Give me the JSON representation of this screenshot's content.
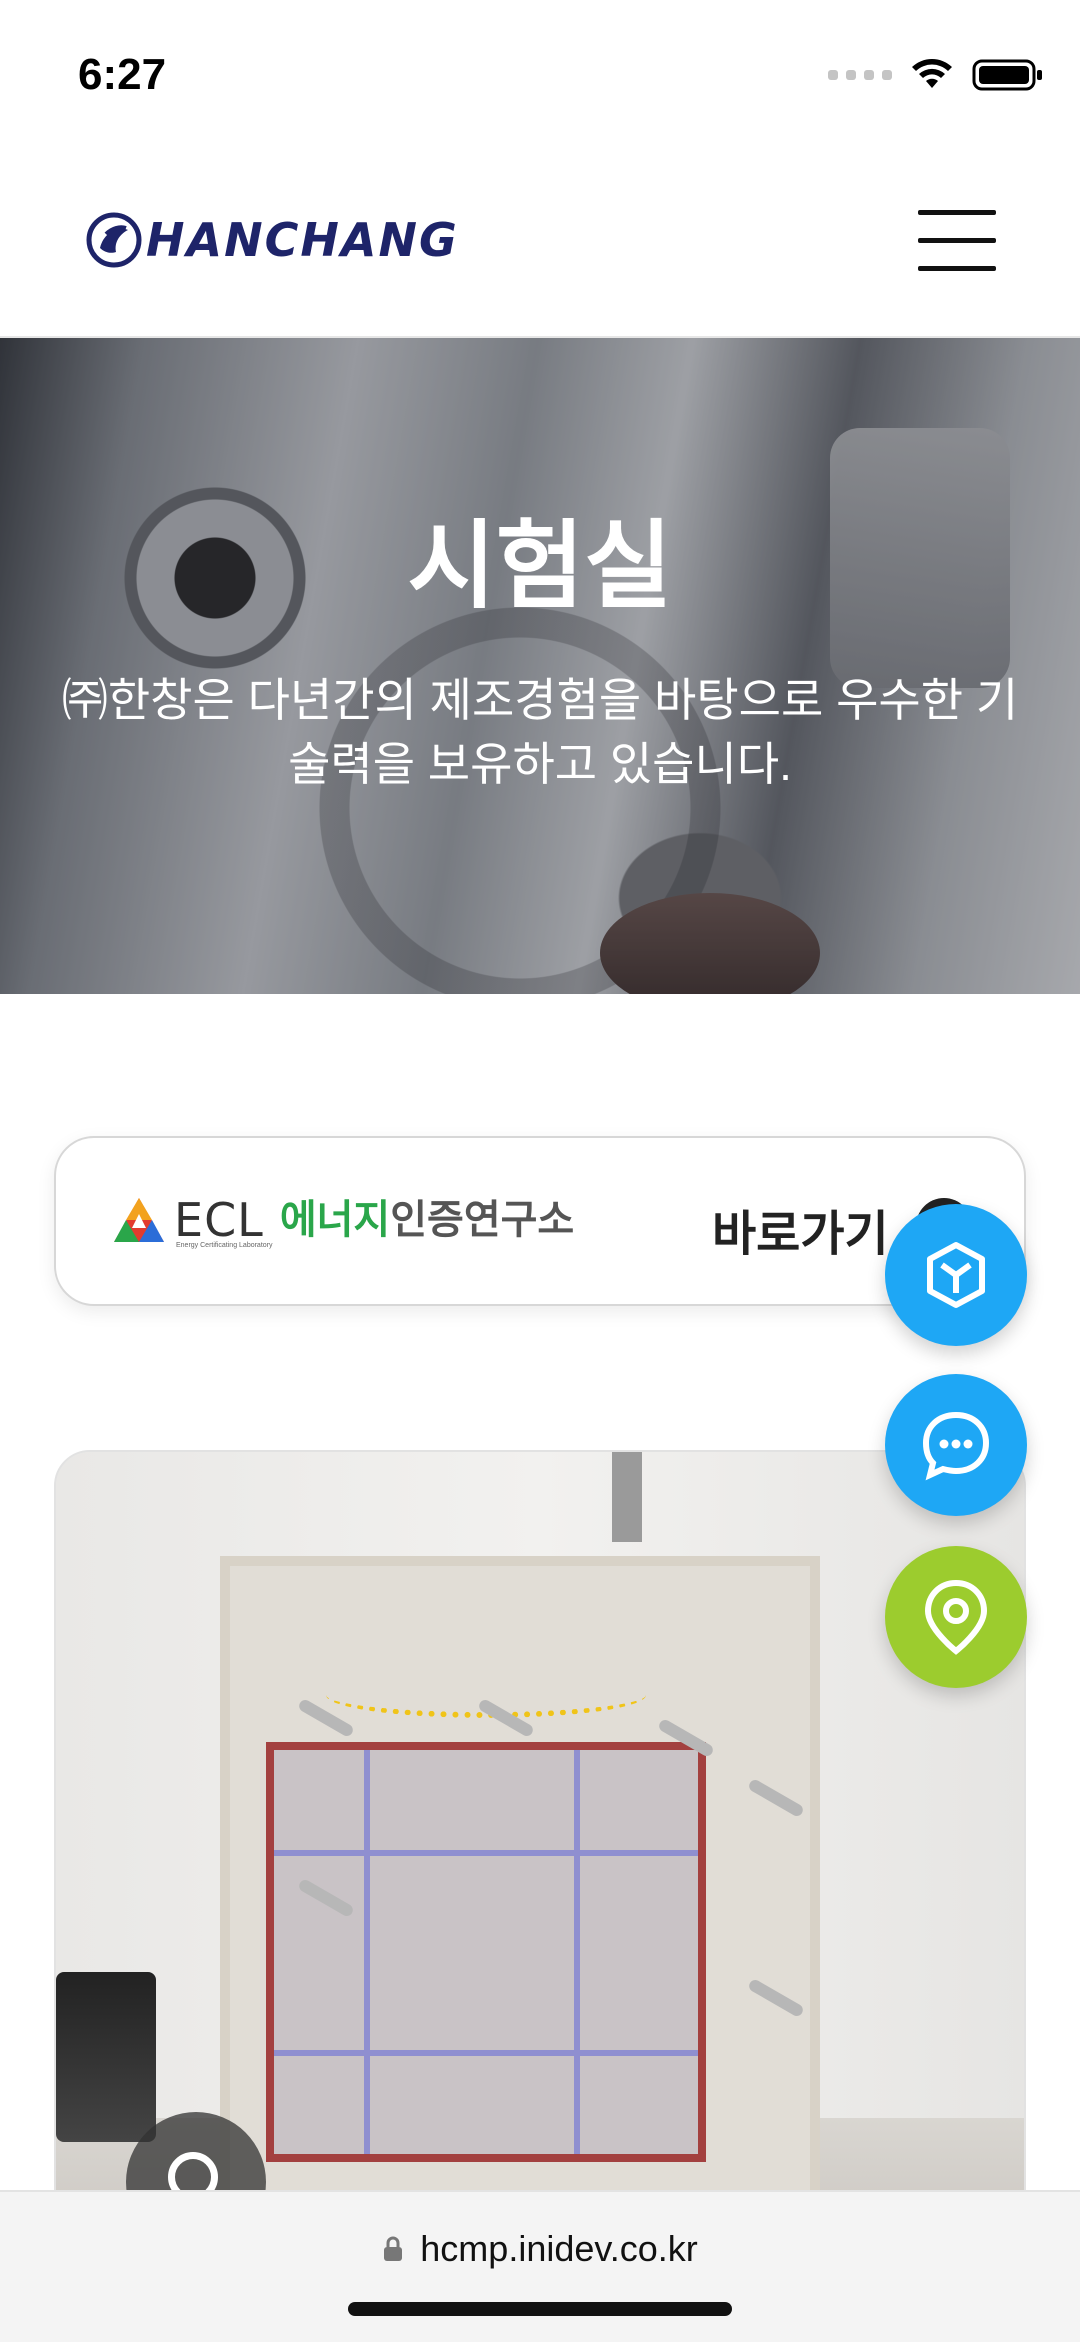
{
  "status_bar": {
    "time": "6:27"
  },
  "header": {
    "logo_text": "HANCHANG",
    "menu_icon": "hamburger-menu-icon"
  },
  "hero": {
    "title": "시험실",
    "subtitle": "㈜한창은 다년간의 제조경험을 바탕으로 우수한 기술력을 보유하고 있습니다."
  },
  "ecl_banner": {
    "logo_latin": "ECL",
    "logo_green": "에너지",
    "logo_gray": "인증연구소",
    "logo_small": "Energy Certificating Laboratory",
    "link_label": "바로가기"
  },
  "floating_buttons": [
    {
      "icon": "cube-icon",
      "color": "#1ea7f5"
    },
    {
      "icon": "chat-icon",
      "color": "#1ea7f5"
    },
    {
      "icon": "location-pin-icon",
      "color": "#9ccc2e"
    }
  ],
  "browser": {
    "url": "hcmp.inidev.co.kr"
  }
}
